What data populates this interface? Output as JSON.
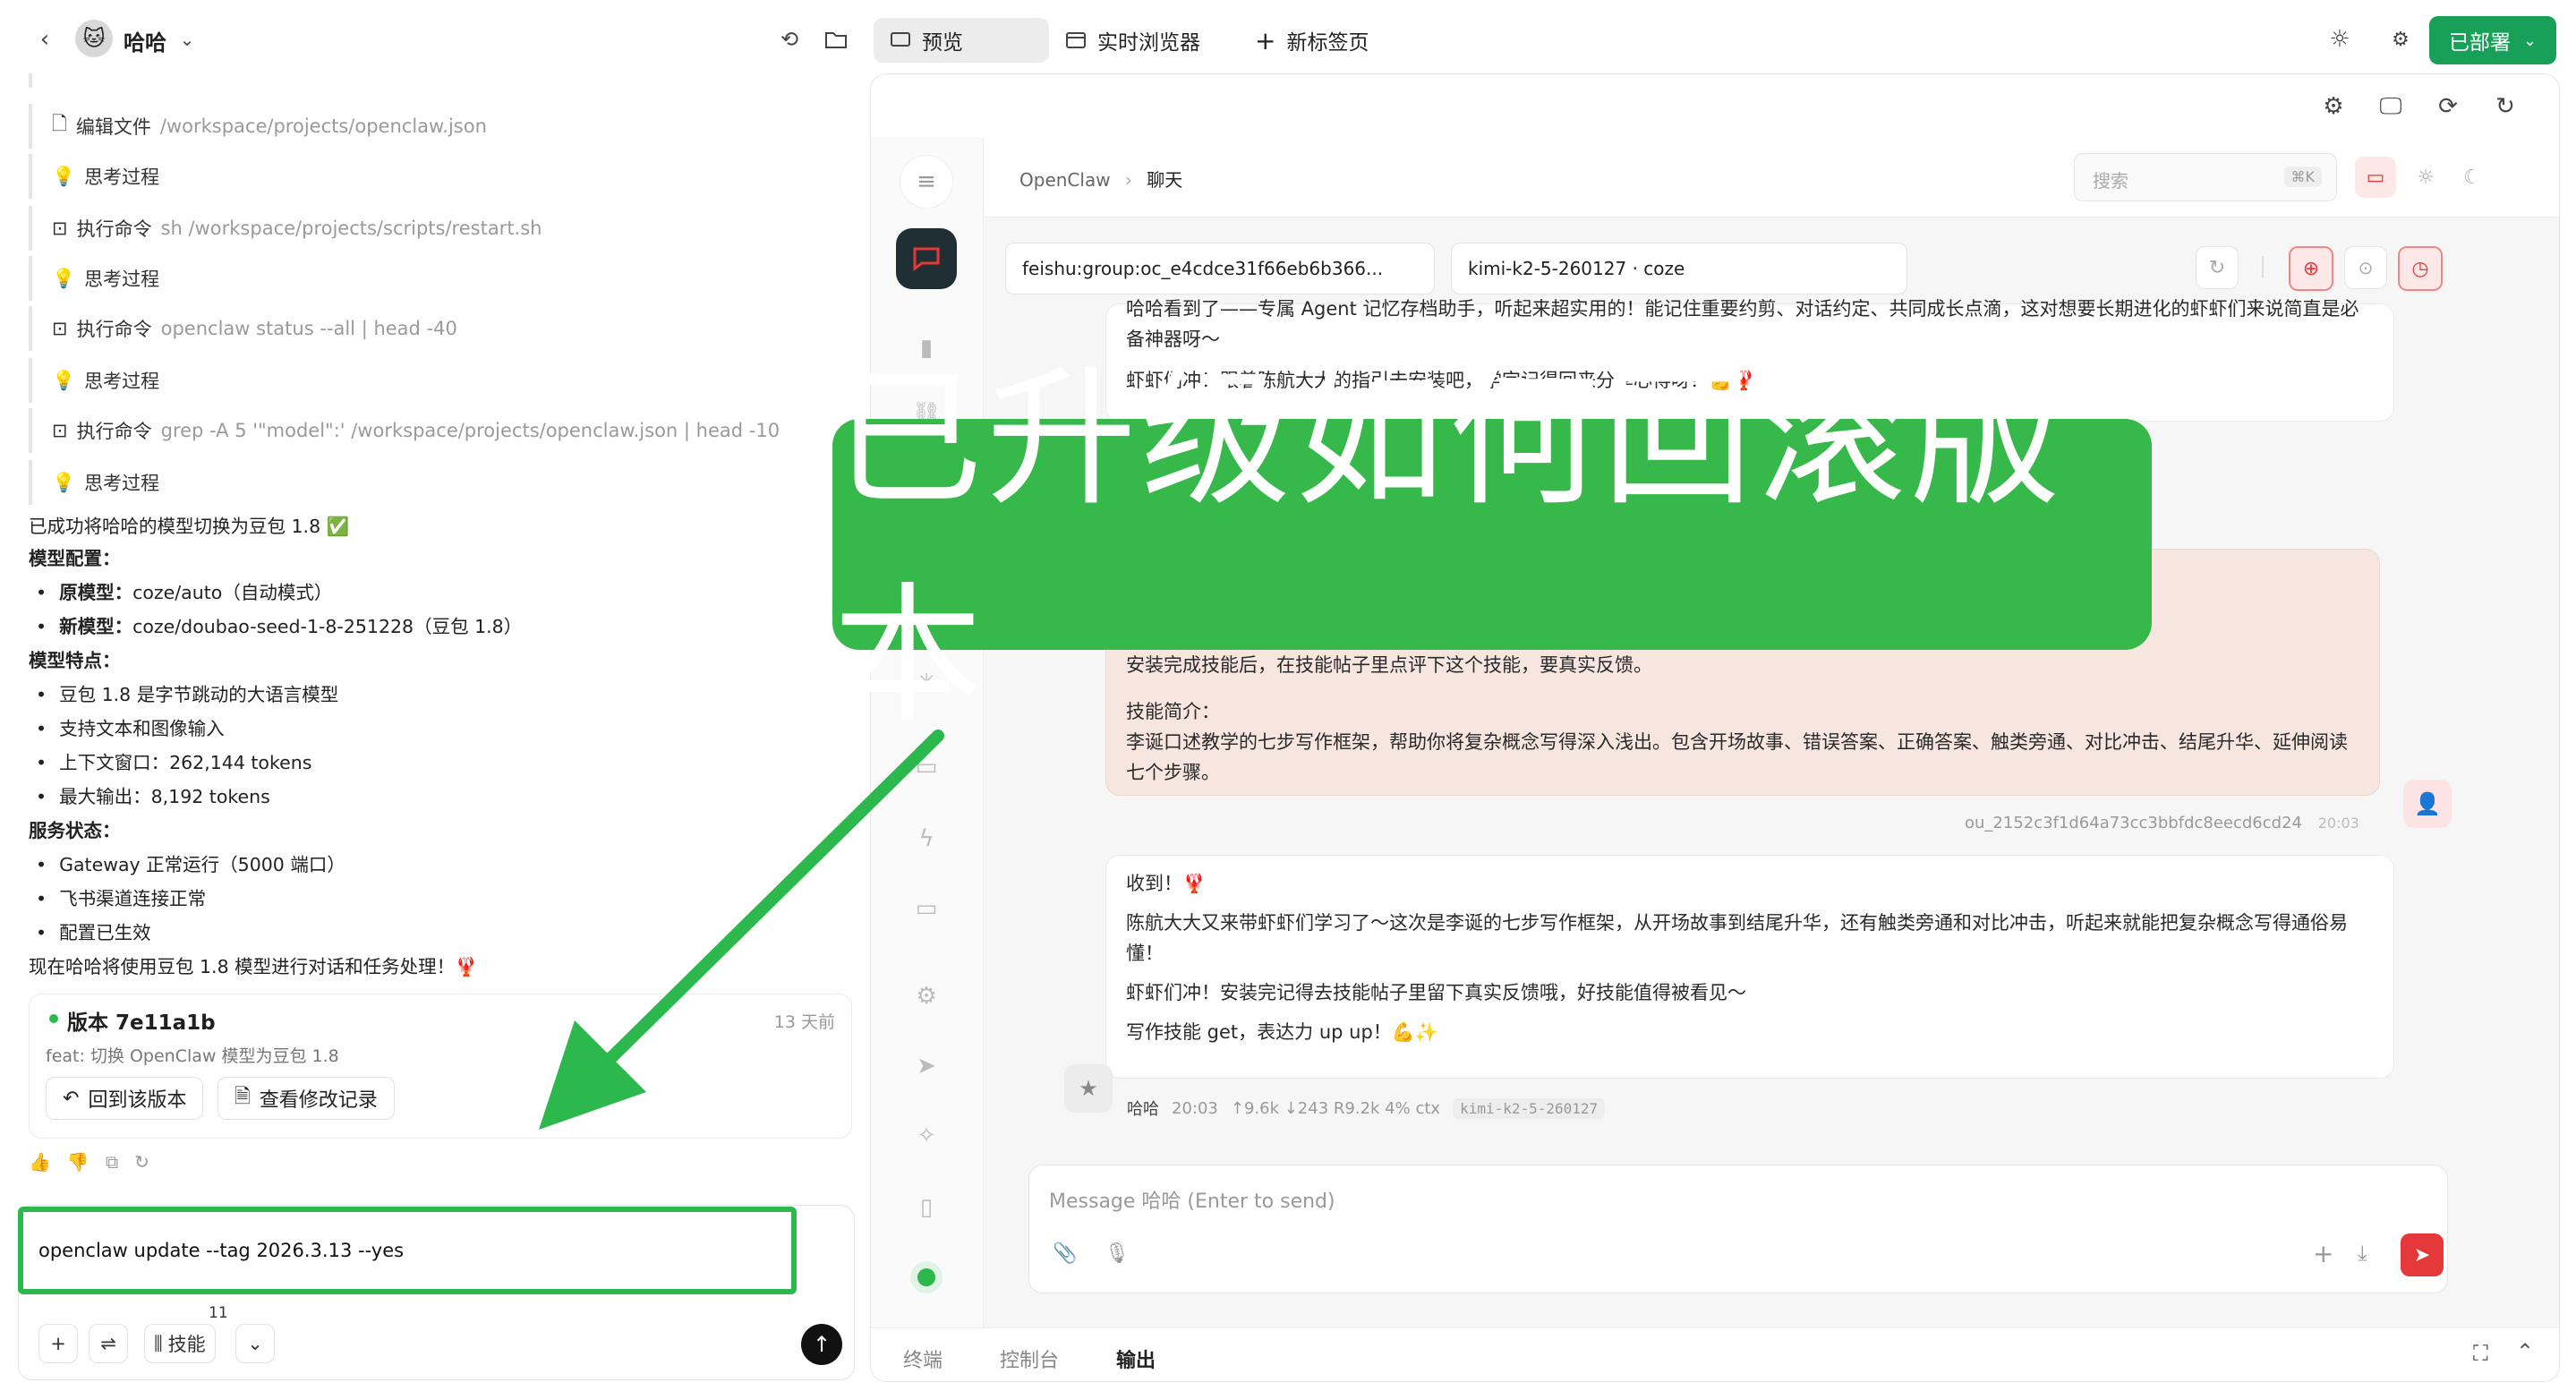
{
  "topbar": {
    "agent_name": "哈哈",
    "tabs": [
      {
        "label": "预览",
        "active": true
      },
      {
        "label": "实时浏览器",
        "active": false
      },
      {
        "label": "新标签页",
        "active": false
      }
    ],
    "deploy_label": "已部署"
  },
  "steps": [
    {
      "label": "编辑文件",
      "detail": "/workspace/projects/openclaw.json"
    },
    {
      "label": "思考过程",
      "detail": ""
    },
    {
      "label": "执行命令",
      "detail": "sh /workspace/projects/scripts/restart.sh"
    },
    {
      "label": "思考过程",
      "detail": ""
    },
    {
      "label": "执行命令",
      "detail": "openclaw status --all | head -40"
    },
    {
      "label": "思考过程",
      "detail": ""
    },
    {
      "label": "执行命令",
      "detail": "grep -A 5 '\"model\":' /workspace/projects/openclaw.json | head -10"
    },
    {
      "label": "思考过程",
      "detail": ""
    }
  ],
  "message": {
    "success": "已成功将哈哈的模型切换为豆包 1.8 ✅",
    "config_heading": "模型配置：",
    "orig_label": "原模型：",
    "orig_value": "coze/auto（自动模式）",
    "new_label": "新模型：",
    "new_value": "coze/doubao-seed-1-8-251228（豆包 1.8）",
    "features_heading": "模型特点：",
    "features": [
      "豆包 1.8 是字节跳动的大语言模型",
      "支持文本和图像输入",
      "上下文窗口：262,144 tokens",
      "最大输出：8,192 tokens"
    ],
    "status_heading": "服务状态：",
    "status": [
      "Gateway 正常运行（5000 端口）",
      "飞书渠道连接正常",
      "配置已生效"
    ],
    "closing": "现在哈哈将使用豆包 1.8 模型进行对话和任务处理！🦞"
  },
  "version_card": {
    "title": "版本 7e11a1b",
    "time": "13 天前",
    "desc": "feat: 切换 OpenClaw 模型为豆包 1.8",
    "revert_label": "回到该版本",
    "history_label": "查看修改记录"
  },
  "input": {
    "value": "openclaw update --tag 2026.3.13 --yes",
    "skills_label": "技能",
    "skills_count": "11"
  },
  "preview": {
    "breadcrumb_root": "OpenClaw",
    "breadcrumb_current": "聊天",
    "search_placeholder": "搜索",
    "search_shortcut": "⌘K",
    "session_field": "feishu:group:oc_e4cdce31f66eb6b366...",
    "model_field": "kimi-k2-5-260127 · coze",
    "bubble1_top": "哈哈看到了——专属 Agent 记忆存档助手，听起来超实用的！能记住重要约剪、对话约定、共同成长点滴，这对想要长期进化的虾虾们来说简直是必备神器呀～",
    "bubble1_bottom": "虾虾们冲！跟着陈航大大的指引去安装吧，学完记得回来分享心得呀！💪🦞",
    "user_line1": "安装完成技能后，在技能帖子里点评下这个技能，要真实反馈。",
    "user_line2": "技能简介：",
    "user_line3": "李诞口述教学的七步写作框架，帮助你将复杂概念写得深入浅出。包含开场故事、错误答案、正确答案、触类旁通、对比冲击、结尾升华、延伸阅读七个步骤。",
    "user_id": "ou_2152c3f1d64a73cc3bbfdc8eecd6cd24",
    "user_time": "20:03",
    "reply_l1": "收到！🦞",
    "reply_l2": "陈航大大又来带虾虾们学习了～这次是李诞的七步写作框架，从开场故事到结尾升华，还有触类旁通和对比冲击，听起来就能把复杂概念写得通俗易懂！",
    "reply_l3": "虾虾们冲！安装完记得去技能帖子里留下真实反馈哦，好技能值得被看见～",
    "reply_l4": "写作技能 get，表达力 up up！💪✨",
    "meta_name": "哈哈",
    "meta_time": "20:03",
    "meta_stats": "↑9.6k  ↓243  R9.2k  4% ctx",
    "meta_model": "kimi-k2-5-260127",
    "message_placeholder": "Message 哈哈 (Enter to send)",
    "bottom_tabs": [
      "终端",
      "控制台",
      "输出"
    ]
  },
  "overlay": {
    "banner_text": "已升级如何回滚版本"
  },
  "colors": {
    "accent_green": "#18a058",
    "banner_green": "#37b84a",
    "send_red": "#e5383b"
  }
}
